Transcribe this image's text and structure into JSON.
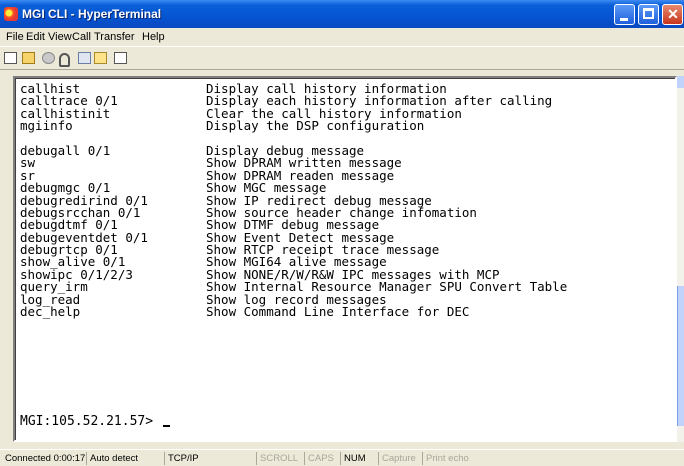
{
  "window": {
    "title": "MGI CLI - HyperTerminal"
  },
  "menu": {
    "items": [
      "File",
      "Edit",
      "View",
      "Call",
      "Transfer",
      "Help"
    ]
  },
  "toolbar": {
    "icons": [
      "new-icon",
      "open-icon",
      "disconnect-icon",
      "dial-icon",
      "send-icon",
      "receive-icon",
      "properties-icon"
    ]
  },
  "terminal": {
    "group1": [
      {
        "cmd": "callhist",
        "desc": "Display call history information"
      },
      {
        "cmd": "calltrace 0/1",
        "desc": "Display each history information after calling"
      },
      {
        "cmd": "callhistinit",
        "desc": "Clear the call history information"
      },
      {
        "cmd": "mgiinfo",
        "desc": "Display the DSP configuration"
      }
    ],
    "group2": [
      {
        "cmd": "debugall 0/1",
        "desc": "Display debug message"
      },
      {
        "cmd": "sw",
        "desc": "Show DPRAM written message"
      },
      {
        "cmd": "sr",
        "desc": "Show DPRAM readen message"
      },
      {
        "cmd": "debugmgc 0/1",
        "desc": "Show MGC message"
      },
      {
        "cmd": "debugredirind 0/1",
        "desc": "Show IP redirect debug message"
      },
      {
        "cmd": "debugsrcchan 0/1",
        "desc": "Show source header change infomation"
      },
      {
        "cmd": "debugdtmf 0/1",
        "desc": "Show DTMF debug message"
      },
      {
        "cmd": "debugeventdet 0/1",
        "desc": "Show Event Detect message"
      },
      {
        "cmd": "debugrtcp 0/1",
        "desc": "Show RTCP receipt trace message"
      },
      {
        "cmd": "show_alive 0/1",
        "desc": "Show MGI64 alive message"
      },
      {
        "cmd": "showipc 0/1/2/3",
        "desc": "Show NONE/R/W/R&W IPC messages with MCP"
      },
      {
        "cmd": "query_irm",
        "desc": "Show Internal Resource Manager SPU Convert Table"
      },
      {
        "cmd": "log_read",
        "desc": "Show log record messages"
      },
      {
        "cmd": "dec_help",
        "desc": "Show Command Line Interface for DEC"
      }
    ],
    "prompt": "MGI:105.52.21.57> "
  },
  "status": {
    "connected": "Connected 0:00:17",
    "detect": "Auto detect",
    "protocol": "TCP/IP",
    "scroll": "SCROLL",
    "caps": "CAPS",
    "num": "NUM",
    "capture": "Capture",
    "print_echo": "Print echo"
  }
}
